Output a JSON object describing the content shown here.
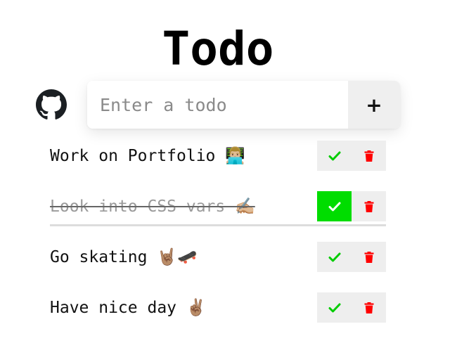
{
  "app": {
    "title": "Todo"
  },
  "header": {
    "github_icon": "github-icon"
  },
  "input": {
    "placeholder": "Enter a todo",
    "value": "",
    "add_label": "+"
  },
  "todos": [
    {
      "text": "Work on Portfolio 👨🏼‍💻",
      "done": false
    },
    {
      "text": "Look into CSS vars ✍🏼",
      "done": true
    },
    {
      "text": "Go skating 🤘🏽🛹",
      "done": false
    },
    {
      "text": "Have nice day ✌🏽",
      "done": false
    }
  ],
  "colors": {
    "done_active": "#00dd00",
    "check_icon": "#00cc00",
    "trash_icon": "#ff0000",
    "button_bg": "#eeeeee"
  },
  "icons": {
    "complete": "check-icon",
    "delete": "trash-icon"
  }
}
